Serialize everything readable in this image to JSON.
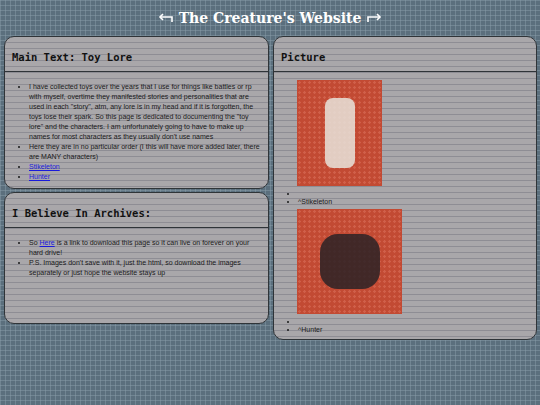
{
  "header": {
    "title": "The Creature's Website"
  },
  "main_card": {
    "heading": "Main Text: Toy Lore",
    "items": [
      {
        "kind": "text",
        "text": "I have collected toys over the years that I use for things like battles or rp with myself, overtime they manifested stories and personalities that are used in each \"story\", atm, any lore is in my head and if it is forgotten, the toys lose their spark. So this page is dedicated to documenting the \"toy lore\" and the characters. I am unfortunately going to have to make up names for most characters as they usually don't use names"
      },
      {
        "kind": "text",
        "text": "Here they are in no particular order (I this will have more added later, there are MANY characters)"
      },
      {
        "kind": "link",
        "text": "Stikeleton"
      },
      {
        "kind": "link",
        "text": "Hunter"
      }
    ]
  },
  "archive_card": {
    "heading": "I Believe In Archives:",
    "items": [
      {
        "before": "So ",
        "link": "Here",
        "after": " is a link to download this page so it can live on forever on your hard drive!"
      },
      {
        "before": "P.S. Images don't save with it, just the html, so download the images separately or just hope the website stays up",
        "link": "",
        "after": ""
      }
    ]
  },
  "picture_card": {
    "heading": "Picture",
    "pictures": [
      {
        "caption": "^Stikeleton"
      },
      {
        "caption": "^Hunter"
      }
    ]
  }
}
